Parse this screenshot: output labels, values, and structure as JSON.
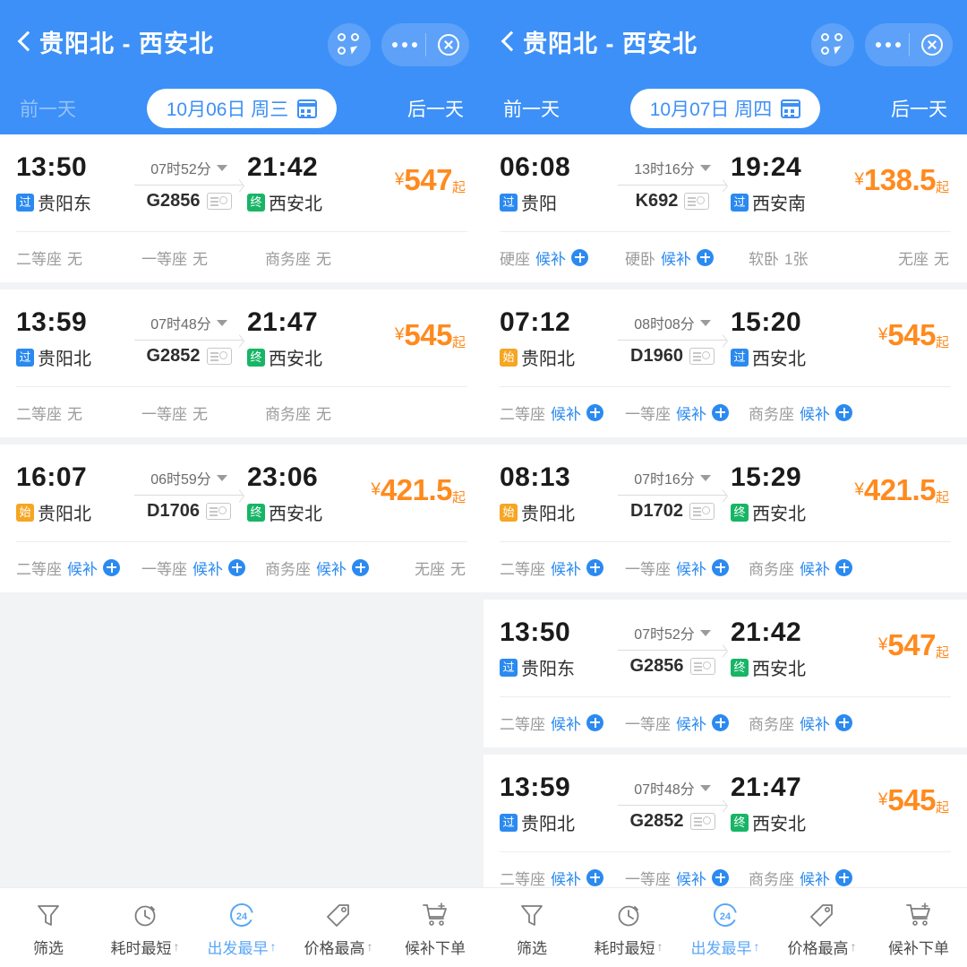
{
  "panels": [
    {
      "header": {
        "title": "贵阳北 - 西安北",
        "back_icon": "chevron-left-icon",
        "prev_day": "前一天",
        "next_day": "后一天",
        "prev_day_dimmed": true,
        "date": "10月06日 周三",
        "calendar_icon": "calendar-icon"
      },
      "trains": [
        {
          "dep_time": "13:50",
          "dep_badge": "过",
          "dep_badge_type": "pass",
          "dep_station": "贵阳东",
          "duration": "07时52分",
          "train_no": "G2856",
          "arr_time": "21:42",
          "arr_badge": "终",
          "arr_badge_type": "end",
          "arr_station": "西安北",
          "price_currency": "¥",
          "price": "547",
          "price_suffix": "起",
          "seats": [
            {
              "label": "二等座",
              "value": "无",
              "houbu": false
            },
            {
              "label": "一等座",
              "value": "无",
              "houbu": false
            },
            {
              "label": "商务座",
              "value": "无",
              "houbu": false
            }
          ]
        },
        {
          "dep_time": "13:59",
          "dep_badge": "过",
          "dep_badge_type": "pass",
          "dep_station": "贵阳北",
          "duration": "07时48分",
          "train_no": "G2852",
          "arr_time": "21:47",
          "arr_badge": "终",
          "arr_badge_type": "end",
          "arr_station": "西安北",
          "price_currency": "¥",
          "price": "545",
          "price_suffix": "起",
          "seats": [
            {
              "label": "二等座",
              "value": "无",
              "houbu": false
            },
            {
              "label": "一等座",
              "value": "无",
              "houbu": false
            },
            {
              "label": "商务座",
              "value": "无",
              "houbu": false
            }
          ]
        },
        {
          "dep_time": "16:07",
          "dep_badge": "始",
          "dep_badge_type": "start",
          "dep_station": "贵阳北",
          "duration": "06时59分",
          "train_no": "D1706",
          "arr_time": "23:06",
          "arr_badge": "终",
          "arr_badge_type": "end",
          "arr_station": "西安北",
          "price_currency": "¥",
          "price": "421.5",
          "price_suffix": "起",
          "seats": [
            {
              "label": "二等座",
              "value": "候补",
              "houbu": true
            },
            {
              "label": "一等座",
              "value": "候补",
              "houbu": true
            },
            {
              "label": "商务座",
              "value": "候补",
              "houbu": true
            },
            {
              "label": "无座",
              "value": "无",
              "houbu": false
            }
          ]
        }
      ],
      "tabbar": [
        {
          "icon": "filter-icon",
          "label": "筛选",
          "sort": "",
          "active": false
        },
        {
          "icon": "stopwatch-icon",
          "label": "耗时最短",
          "sort": "↑",
          "active": false
        },
        {
          "icon": "clock24-icon",
          "label": "出发最早",
          "sort": "↑",
          "active": true,
          "icon_text": "24"
        },
        {
          "icon": "price-tag-icon",
          "label": "价格最高",
          "sort": "↑",
          "active": false
        },
        {
          "icon": "cart-plus-icon",
          "label": "候补下单",
          "sort": "",
          "active": false
        }
      ]
    },
    {
      "header": {
        "title": "贵阳北 - 西安北",
        "back_icon": "chevron-left-icon",
        "prev_day": "前一天",
        "next_day": "后一天",
        "prev_day_dimmed": false,
        "date": "10月07日 周四",
        "calendar_icon": "calendar-icon"
      },
      "trains": [
        {
          "dep_time": "06:08",
          "dep_badge": "过",
          "dep_badge_type": "pass",
          "dep_station": "贵阳",
          "duration": "13时16分",
          "train_no": "K692",
          "arr_time": "19:24",
          "arr_badge": "过",
          "arr_badge_type": "pass",
          "arr_station": "西安南",
          "price_currency": "¥",
          "price": "138.5",
          "price_suffix": "起",
          "seats": [
            {
              "label": "硬座",
              "value": "候补",
              "houbu": true
            },
            {
              "label": "硬卧",
              "value": "候补",
              "houbu": true
            },
            {
              "label": "软卧",
              "value": "1张",
              "houbu": false
            },
            {
              "label": "无座",
              "value": "无",
              "houbu": false
            }
          ]
        },
        {
          "dep_time": "07:12",
          "dep_badge": "始",
          "dep_badge_type": "start",
          "dep_station": "贵阳北",
          "duration": "08时08分",
          "train_no": "D1960",
          "arr_time": "15:20",
          "arr_badge": "过",
          "arr_badge_type": "pass",
          "arr_station": "西安北",
          "price_currency": "¥",
          "price": "545",
          "price_suffix": "起",
          "seats": [
            {
              "label": "二等座",
              "value": "候补",
              "houbu": true
            },
            {
              "label": "一等座",
              "value": "候补",
              "houbu": true
            },
            {
              "label": "商务座",
              "value": "候补",
              "houbu": true
            }
          ]
        },
        {
          "dep_time": "08:13",
          "dep_badge": "始",
          "dep_badge_type": "start",
          "dep_station": "贵阳北",
          "duration": "07时16分",
          "train_no": "D1702",
          "arr_time": "15:29",
          "arr_badge": "终",
          "arr_badge_type": "end",
          "arr_station": "西安北",
          "price_currency": "¥",
          "price": "421.5",
          "price_suffix": "起",
          "seats": [
            {
              "label": "二等座",
              "value": "候补",
              "houbu": true
            },
            {
              "label": "一等座",
              "value": "候补",
              "houbu": true
            },
            {
              "label": "商务座",
              "value": "候补",
              "houbu": true
            }
          ]
        },
        {
          "dep_time": "13:50",
          "dep_badge": "过",
          "dep_badge_type": "pass",
          "dep_station": "贵阳东",
          "duration": "07时52分",
          "train_no": "G2856",
          "arr_time": "21:42",
          "arr_badge": "终",
          "arr_badge_type": "end",
          "arr_station": "西安北",
          "price_currency": "¥",
          "price": "547",
          "price_suffix": "起",
          "seats": [
            {
              "label": "二等座",
              "value": "候补",
              "houbu": true
            },
            {
              "label": "一等座",
              "value": "候补",
              "houbu": true
            },
            {
              "label": "商务座",
              "value": "候补",
              "houbu": true
            }
          ]
        },
        {
          "dep_time": "13:59",
          "dep_badge": "过",
          "dep_badge_type": "pass",
          "dep_station": "贵阳北",
          "duration": "07时48分",
          "train_no": "G2852",
          "arr_time": "21:47",
          "arr_badge": "终",
          "arr_badge_type": "end",
          "arr_station": "西安北",
          "price_currency": "¥",
          "price": "545",
          "price_suffix": "起",
          "seats": [
            {
              "label": "二等座",
              "value": "候补",
              "houbu": true
            },
            {
              "label": "一等座",
              "value": "候补",
              "houbu": true
            },
            {
              "label": "商务座",
              "value": "候补",
              "houbu": true
            }
          ]
        }
      ],
      "tabbar": [
        {
          "icon": "filter-icon",
          "label": "筛选",
          "sort": "",
          "active": false
        },
        {
          "icon": "stopwatch-icon",
          "label": "耗时最短",
          "sort": "↑",
          "active": false
        },
        {
          "icon": "clock24-icon",
          "label": "出发最早",
          "sort": "↑",
          "active": true,
          "icon_text": "24"
        },
        {
          "icon": "price-tag-icon",
          "label": "价格最高",
          "sort": "↑",
          "active": false
        },
        {
          "icon": "cart-plus-icon",
          "label": "候补下单",
          "sort": "",
          "active": false
        }
      ]
    }
  ],
  "colors": {
    "header_blue": "#3d90f7",
    "price_orange": "#ff8a1e",
    "badge_pass": "#2b8af0",
    "badge_start": "#f5a623",
    "badge_end": "#18b566",
    "link_blue": "#2b8af0",
    "page_bg": "#f2f3f5"
  }
}
